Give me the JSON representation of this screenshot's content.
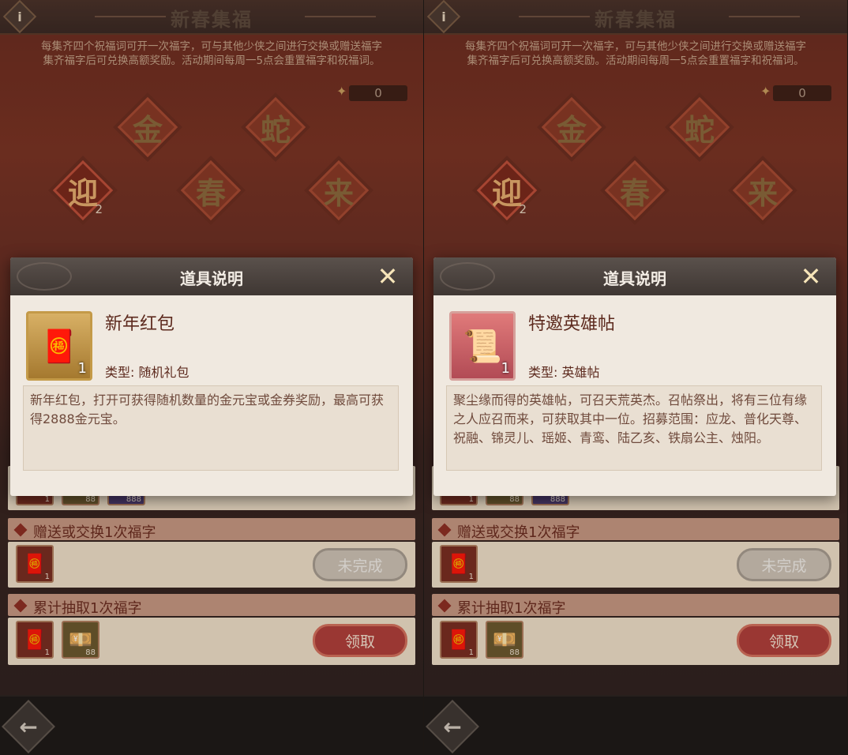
{
  "panels": [
    {
      "title": "新春集福",
      "description_line1": "每集齐四个祝福词可开一次福字，可与其他少侠之间进行交换或赠送福字",
      "description_line2": "集齐福字后可兑换高额奖励。活动期间每周一5点会重置福字和祝福词。",
      "counter": "0",
      "chars": [
        "金",
        "蛇",
        "迎",
        "春",
        "来"
      ],
      "char_count": "2",
      "dialog": {
        "title": "道具说明",
        "item_name": "新年红包",
        "item_qty": "1",
        "item_type": "类型: 随机礼包",
        "item_desc": "新年红包，打开可获得随机数量的金元宝或金券奖励，最高可获得2888金元宝。",
        "icon": "red-envelope-icon"
      },
      "rows": [
        {
          "title": "赠送或交换1次福字",
          "items": [
            {
              "qty": "1"
            }
          ],
          "button": "未完成"
        },
        {
          "title": "累计抽取1次福字",
          "items": [
            {
              "qty": "1"
            },
            {
              "qty": "88"
            }
          ],
          "button": "领取"
        }
      ],
      "partial_row_qty": [
        "1",
        "88",
        "888"
      ]
    },
    {
      "title": "新春集福",
      "description_line1": "每集齐四个祝福词可开一次福字，可与其他少侠之间进行交换或赠送福字",
      "description_line2": "集齐福字后可兑换高额奖励。活动期间每周一5点会重置福字和祝福词。",
      "counter": "0",
      "chars": [
        "金",
        "蛇",
        "迎",
        "春",
        "来"
      ],
      "char_count": "2",
      "dialog": {
        "title": "道具说明",
        "item_name": "特邀英雄帖",
        "item_qty": "1",
        "item_type": "类型: 英雄帖",
        "item_desc": "聚尘缘而得的英雄帖，可召天荒英杰。召帖祭出，将有三位有缘之人应召而来，可获取其中一位。招募范围：应龙、普化天尊、祝融、锦灵儿、瑶姬、青鸾、陆乙亥、铁扇公主、烛阳。",
        "icon": "hero-scroll-icon"
      },
      "rows": [
        {
          "title": "赠送或交换1次福字",
          "items": [
            {
              "qty": "1"
            }
          ],
          "button": "未完成"
        },
        {
          "title": "累计抽取1次福字",
          "items": [
            {
              "qty": "1"
            },
            {
              "qty": "88"
            }
          ],
          "button": "领取"
        }
      ],
      "partial_row_qty": [
        "1",
        "88",
        "888"
      ]
    }
  ]
}
